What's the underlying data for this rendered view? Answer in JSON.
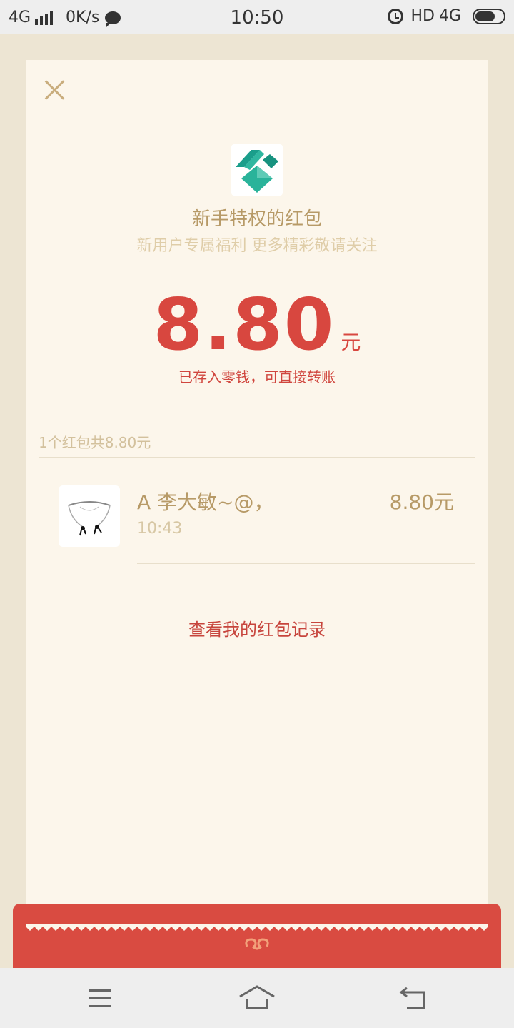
{
  "status_bar": {
    "network": "4G",
    "speed": "0K/s",
    "time": "10:50",
    "hd": "HD",
    "network_right": "4G"
  },
  "header": {
    "title": "新手特权的红包",
    "subtitle": "新用户专属福利 更多精彩敬请关注"
  },
  "amount": {
    "value": "8.80",
    "unit": "元",
    "note": "已存入零钱，可直接转账"
  },
  "summary": {
    "count_text": "1个红包共8.80元"
  },
  "records": [
    {
      "name": "A 李大敏~@，",
      "time": "10:43",
      "amount": "8.80元"
    }
  ],
  "links": {
    "history": "查看我的红包记录"
  },
  "colors": {
    "accent_red": "#d94b41",
    "gold": "#b79a67",
    "panel_bg": "#fcf6eb",
    "page_bg": "#ede5d3"
  },
  "icons": {
    "close": "close-icon",
    "logo": "app-logo-icon",
    "menu": "menu-icon",
    "home": "home-icon",
    "back": "back-icon"
  }
}
